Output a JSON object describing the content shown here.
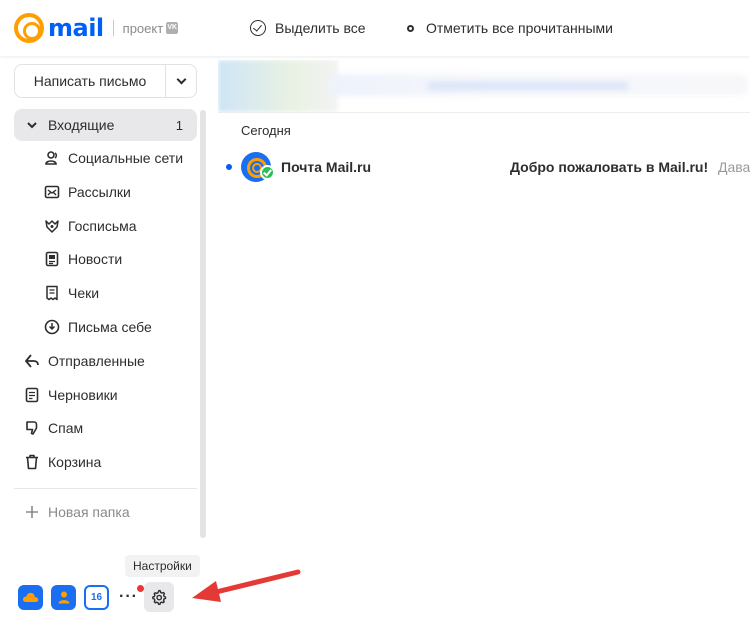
{
  "header": {
    "logo_text": "mail",
    "project_label": "проект",
    "project_badge": "VK",
    "select_all": "Выделить все",
    "mark_all_read": "Отметить все прочитанными"
  },
  "compose": {
    "label": "Написать письмо"
  },
  "folders": {
    "inbox": {
      "label": "Входящие",
      "count": "1"
    },
    "social": {
      "label": "Социальные сети"
    },
    "mailings": {
      "label": "Рассылки"
    },
    "gov": {
      "label": "Госписьма"
    },
    "news": {
      "label": "Новости"
    },
    "receipts": {
      "label": "Чеки"
    },
    "to_self": {
      "label": "Письма себе"
    },
    "sent": {
      "label": "Отправленные"
    },
    "drafts": {
      "label": "Черновики"
    },
    "spam": {
      "label": "Спам"
    },
    "trash": {
      "label": "Корзина"
    },
    "new_folder": {
      "label": "Новая папка"
    }
  },
  "bottom": {
    "calendar_day": "16",
    "more": "···",
    "tooltip": "Настройки"
  },
  "messages": {
    "section": "Сегодня",
    "items": [
      {
        "sender": "Почта Mail.ru",
        "subject": "Добро пожаловать в Mail.ru!",
        "snippet": "Дава"
      }
    ]
  },
  "colors": {
    "brand_blue": "#005ff9",
    "brand_orange": "#ff9e00",
    "annotation_red": "#e53935"
  }
}
